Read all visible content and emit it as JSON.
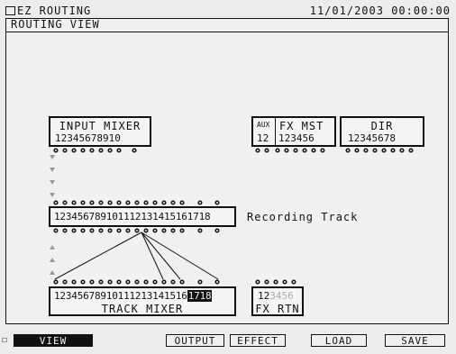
{
  "header": {
    "title": "EZ ROUTING",
    "clock": "11/01/2003 00:00:00"
  },
  "view": {
    "title": "ROUTING VIEW"
  },
  "blocks": {
    "input_mixer": {
      "label": "INPUT MIXER",
      "channels": "12345678910"
    },
    "aux": {
      "label": "AUX",
      "channels": "12"
    },
    "fx_mst": {
      "label": "FX MST",
      "channels": "123456"
    },
    "dir": {
      "label": "DIR",
      "channels": "12345678"
    },
    "recording_track": {
      "label": "Recording Track",
      "channels": "123456789101112131415161718"
    },
    "track_mixer": {
      "label": "TRACK MIXER",
      "channels": "12345678910111213141516",
      "selected": "1718"
    },
    "fx_rtn": {
      "label": "FX RTN",
      "active": "12",
      "inactive": "3456"
    }
  },
  "softkeys": {
    "view": "VIEW",
    "output": "OUTPUT",
    "effect": "EFFECT",
    "load": "LOAD",
    "save": "SAVE"
  }
}
